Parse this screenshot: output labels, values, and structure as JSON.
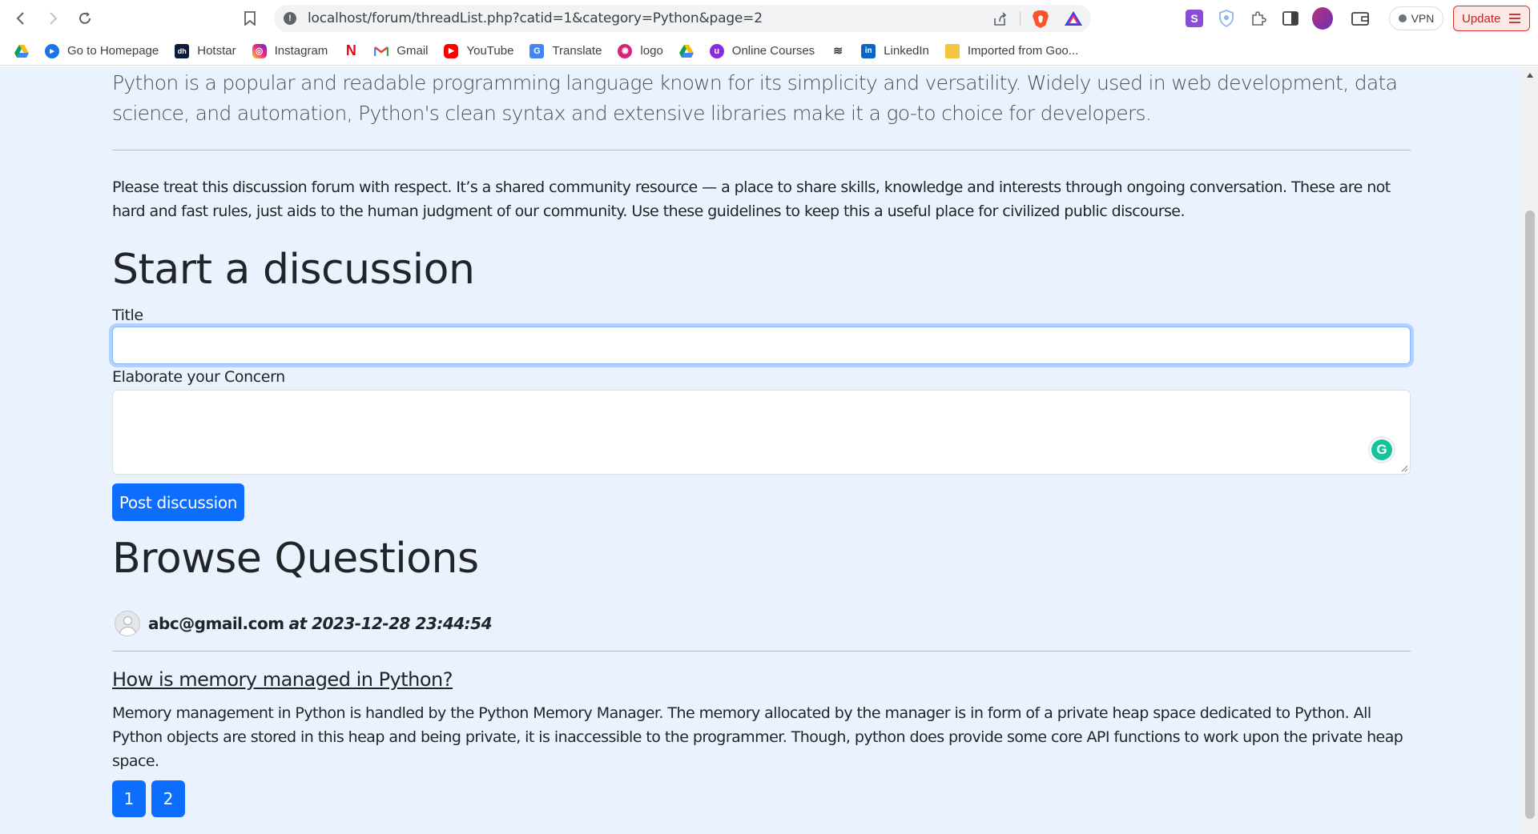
{
  "browser": {
    "url": "localhost/forum/threadList.php?catid=1&category=Python&page=2",
    "vpn_label": "VPN",
    "update_label": "Update"
  },
  "bookmarks": [
    {
      "label": "",
      "icon": "google-drive-icon"
    },
    {
      "label": "Go to Homepage",
      "icon": "homepage-icon"
    },
    {
      "label": "Hotstar",
      "icon": "hotstar-icon"
    },
    {
      "label": "Instagram",
      "icon": "instagram-icon"
    },
    {
      "label": "",
      "icon": "netflix-icon"
    },
    {
      "label": "Gmail",
      "icon": "gmail-icon"
    },
    {
      "label": "YouTube",
      "icon": "youtube-icon"
    },
    {
      "label": "Translate",
      "icon": "translate-icon"
    },
    {
      "label": "logo",
      "icon": "logo-icon"
    },
    {
      "label": "",
      "icon": "google-drive-icon"
    },
    {
      "label": "Online Courses",
      "icon": "online-courses-icon"
    },
    {
      "label": "",
      "icon": "stack-icon"
    },
    {
      "label": "LinkedIn",
      "icon": "linkedin-icon"
    },
    {
      "label": "Imported from Goo...",
      "icon": "folder-icon"
    }
  ],
  "page": {
    "category_description": "Python is a popular and readable programming language known for its simplicity and versatility. Widely used in web development, data science, and automation, Python's clean syntax and extensive libraries make it a go-to choice for developers.",
    "guidelines": "Please treat this discussion forum with respect. It’s a shared community resource — a place to share skills, knowledge and interests through ongoing conversation. These are not hard and fast rules, just aids to the human judgment of our community. Use these guidelines to keep this a useful place for civilized public discourse.",
    "start_heading": "Start a discussion",
    "form": {
      "title_label": "Title",
      "title_value": "",
      "concern_label": "Elaborate your Concern",
      "concern_value": "",
      "submit_label": "Post discussion"
    },
    "browse_heading": "Browse Questions",
    "threads": [
      {
        "user": "abc@gmail.com",
        "timestamp": "at 2023-12-28 23:44:54",
        "title": "How is memory managed in Python?",
        "body": "Memory management in Python is handled by the Python Memory Manager. The memory allocated by the manager is in form of a private heap space dedicated to Python. All Python objects are stored in this heap and being private, it is inaccessible to the programmer. Though, python does provide some core API functions to work upon the private heap space."
      }
    ],
    "pagination": [
      "1",
      "2"
    ]
  },
  "colors": {
    "page_bg": "#eaf2fd",
    "primary": "#0d6efd",
    "text": "#212529"
  }
}
